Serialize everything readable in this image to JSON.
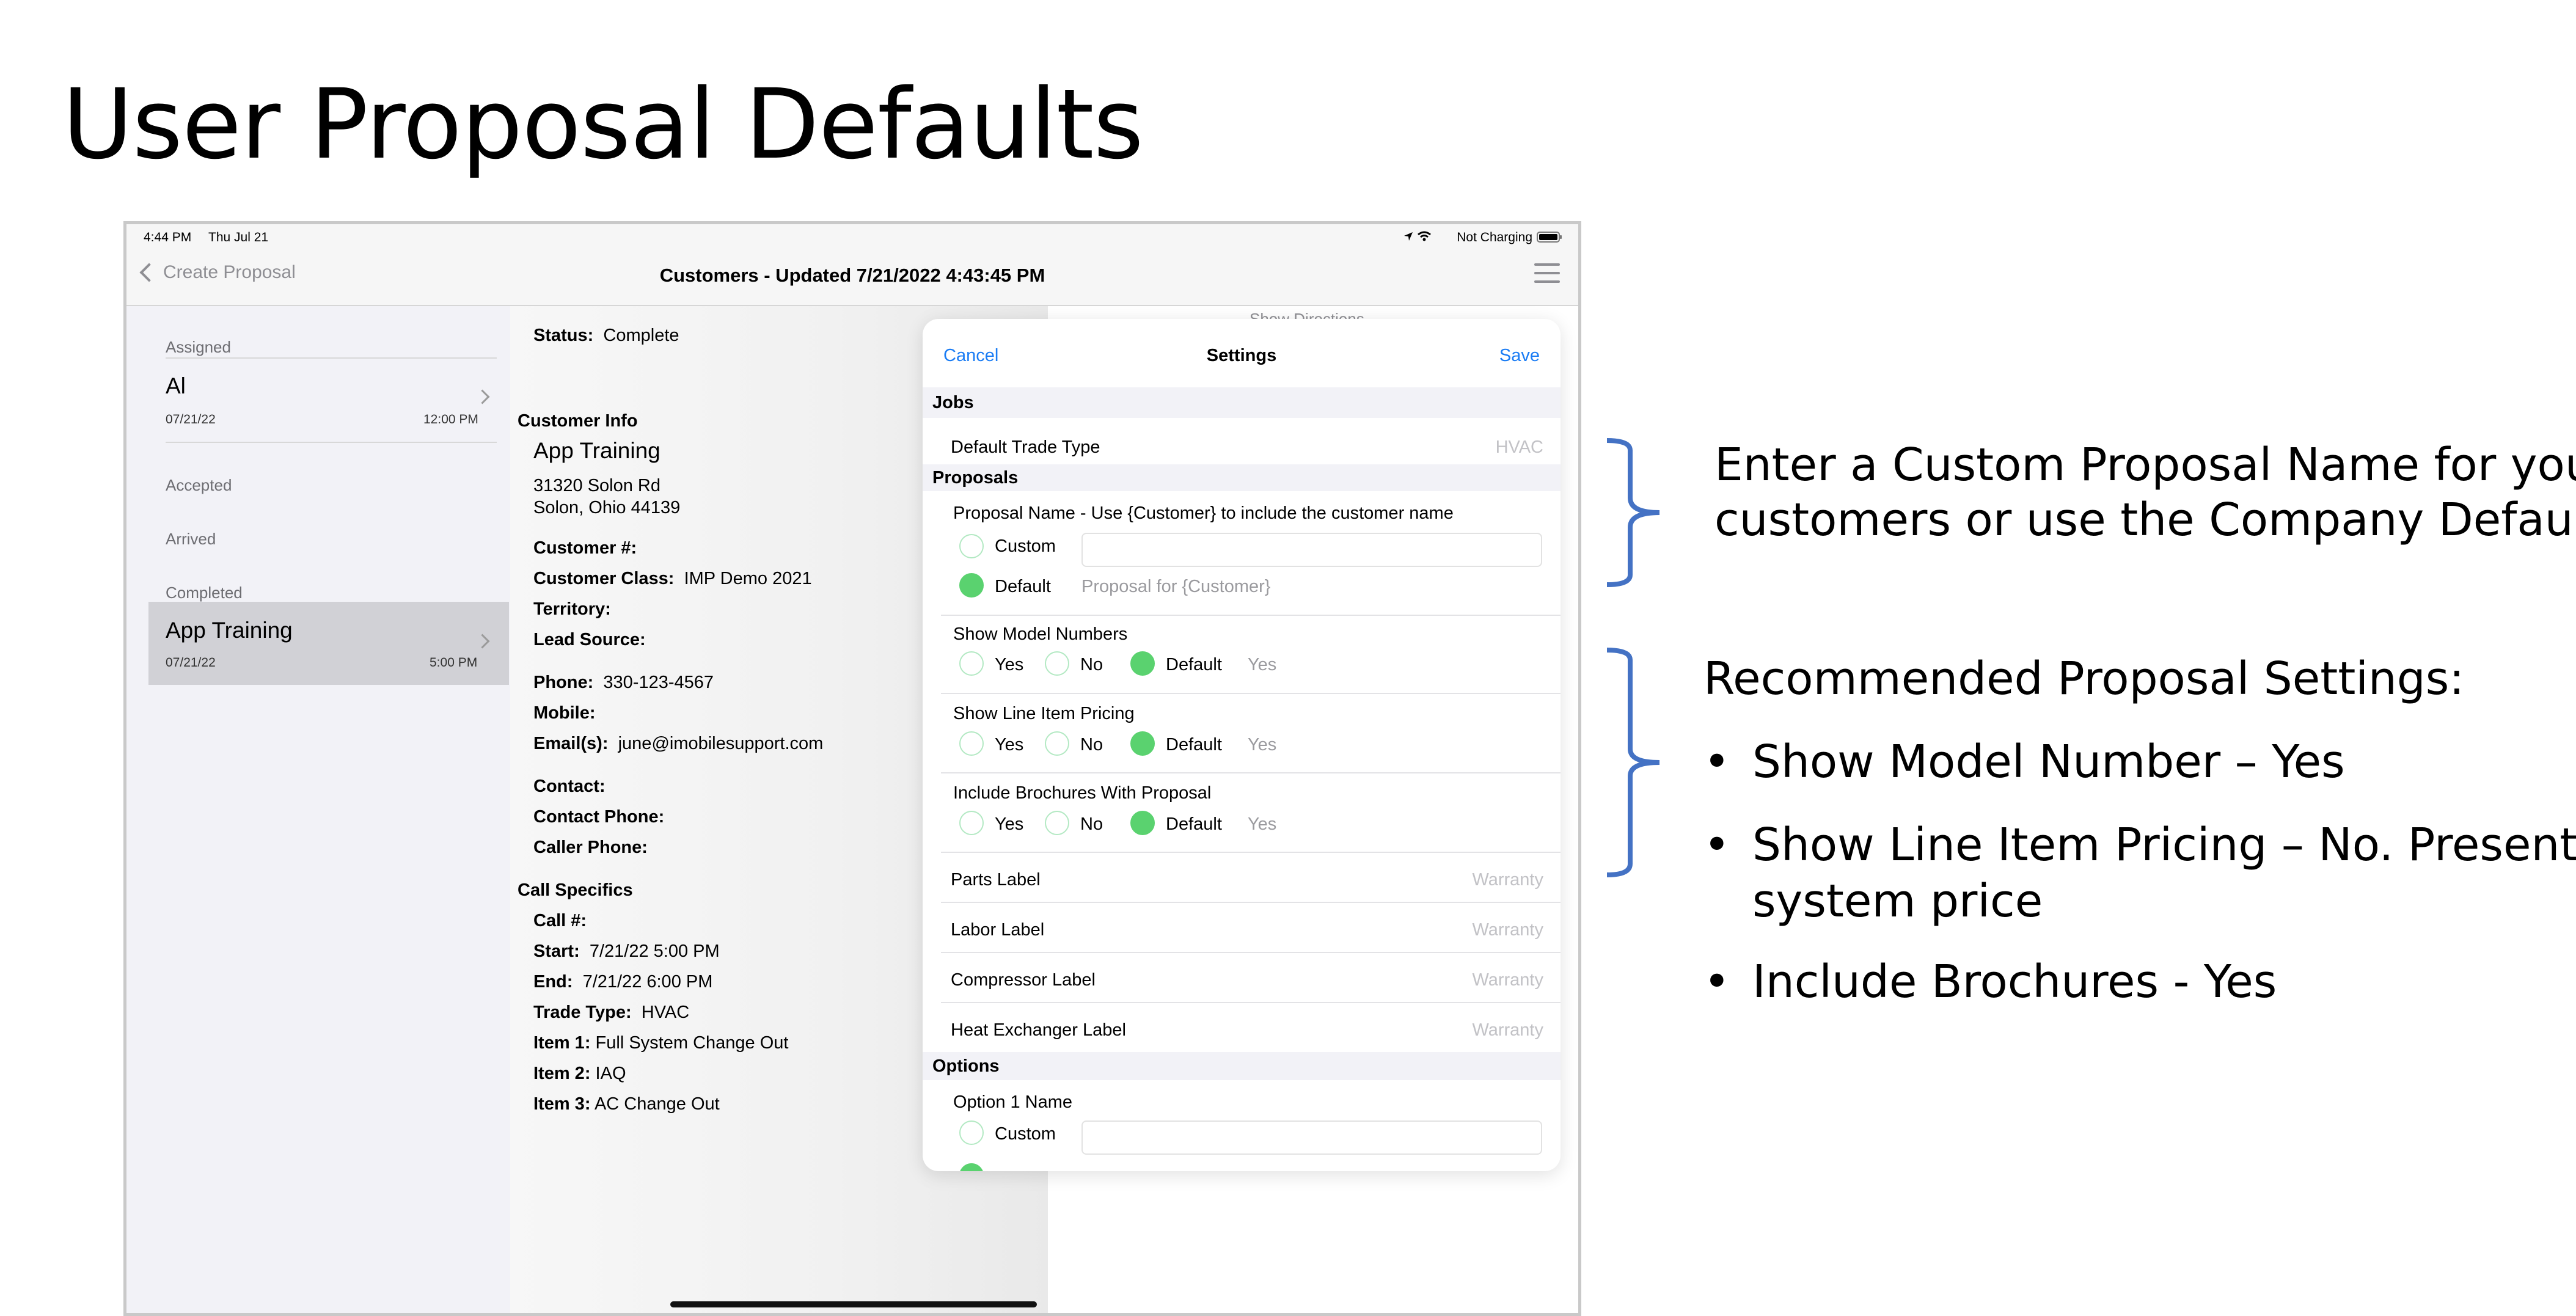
{
  "slide": {
    "title": "User Proposal Defaults"
  },
  "status_bar": {
    "time": "4:44 PM",
    "date": "Thu Jul 21",
    "battery": "Not Charging"
  },
  "nav": {
    "back_label": "Create Proposal",
    "title": "Customers - Updated 7/21/2022 4:43:45 PM"
  },
  "list": {
    "sections": {
      "assigned": "Assigned",
      "accepted": "Accepted",
      "arrived": "Arrived",
      "completed": "Completed"
    },
    "assigned_item": {
      "name": "Al",
      "date": "07/21/22",
      "time": "12:00 PM"
    },
    "completed_item": {
      "name": "App Training",
      "date": "07/21/22",
      "time": "5:00 PM"
    }
  },
  "detail": {
    "status_label": "Status:",
    "status_value": "Complete",
    "customer_info_header": "Customer Info",
    "customer_name": "App Training",
    "address1": "31320 Solon Rd",
    "address2": "Solon, Ohio 44139",
    "customer_num_label": "Customer #:",
    "customer_class_label": "Customer Class:",
    "customer_class_value": "IMP Demo 2021",
    "territory_label": "Territory:",
    "lead_source_label": "Lead Source:",
    "phone_label": "Phone:",
    "phone_value": "330-123-4567",
    "mobile_label": "Mobile:",
    "email_label": "Email(s):",
    "email_value": "june@imobilesupport.com",
    "contact_label": "Contact:",
    "contact_phone_label": "Contact Phone:",
    "caller_phone_label": "Caller Phone:",
    "call_specifics_header": "Call Specifics",
    "call_num_label": "Call #:",
    "start_label": "Start:",
    "start_value": "7/21/22 5:00 PM",
    "end_label": "End:",
    "end_value": "7/21/22 6:00 PM",
    "trade_type_label": "Trade Type:",
    "trade_type_value": "HVAC",
    "item1_label": "Item 1:",
    "item1_value": "Full System Change Out",
    "item2_label": "Item 2:",
    "item2_value": "IAQ",
    "item3_label": "Item 3:",
    "item3_value": "AC Change Out",
    "show_directions": "Show Directions"
  },
  "settings": {
    "cancel": "Cancel",
    "title": "Settings",
    "save": "Save",
    "jobs_header": "Jobs",
    "default_trade_type_label": "Default Trade Type",
    "default_trade_type_value": "HVAC",
    "proposals_header": "Proposals",
    "proposal_name_label": "Proposal Name - Use {Customer} to include the customer name",
    "custom_label": "Custom",
    "default_label": "Default",
    "proposal_default_value": "Proposal for {Customer}",
    "show_model_numbers_label": "Show Model Numbers",
    "show_line_item_pricing_label": "Show Line Item Pricing",
    "include_brochures_label": "Include Brochures With Proposal",
    "yes_label": "Yes",
    "no_label": "No",
    "default_value_yes": "Yes",
    "parts_label": "Parts Label",
    "labor_label": "Labor Label",
    "compressor_label": "Compressor Label",
    "heat_exchanger_label": "Heat Exchanger Label",
    "warranty_value": "Warranty",
    "options_header": "Options",
    "option1_name_label": "Option 1 Name"
  },
  "annotations": {
    "top_line1": "Enter a Custom Proposal Name for your",
    "top_line2": "customers or use the Company Default",
    "rec_header": "Recommended Proposal Settings:",
    "bullet1": "Show Model Number – Yes",
    "bullet2_line1": "Show Line Item Pricing – No. Present a",
    "bullet2_line2": "system price",
    "bullet3": "Include Brochures - Yes",
    "bullet_char": "•"
  },
  "colors": {
    "accent_blue": "#1a7cf4",
    "radio_green": "#5ad26f",
    "bracket_blue": "#4472c4"
  }
}
